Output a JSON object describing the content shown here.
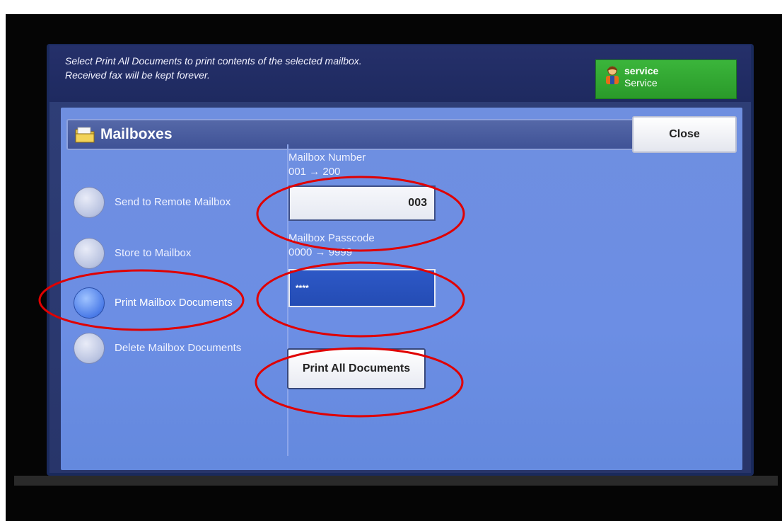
{
  "header": {
    "message_line1": "Select Print All Documents to print contents of the selected mailbox.",
    "message_line2": "Received fax will be kept forever."
  },
  "user": {
    "id": "service",
    "role": "Service",
    "icon": "user-icon"
  },
  "panel": {
    "title": "Mailboxes",
    "icon": "folder-icon",
    "close_label": "Close"
  },
  "options": [
    {
      "label": "Send to Remote Mailbox",
      "selected": false
    },
    {
      "label": "Store to Mailbox",
      "selected": false
    },
    {
      "label": "Print Mailbox Documents",
      "selected": true
    },
    {
      "label": "Delete Mailbox Documents",
      "selected": false
    }
  ],
  "mailbox_number": {
    "label": "Mailbox Number",
    "range": "001 → 200",
    "value": "003"
  },
  "mailbox_passcode": {
    "label": "Mailbox Passcode",
    "range": "0000 → 9999",
    "value": "****"
  },
  "print_all_label": "Print All Documents",
  "colors": {
    "panel": "#6f8fe0",
    "screen": "#2f3f78",
    "badge": "#2ea52e",
    "passcode_field": "#2d58c6",
    "annotation": "#e00000"
  }
}
